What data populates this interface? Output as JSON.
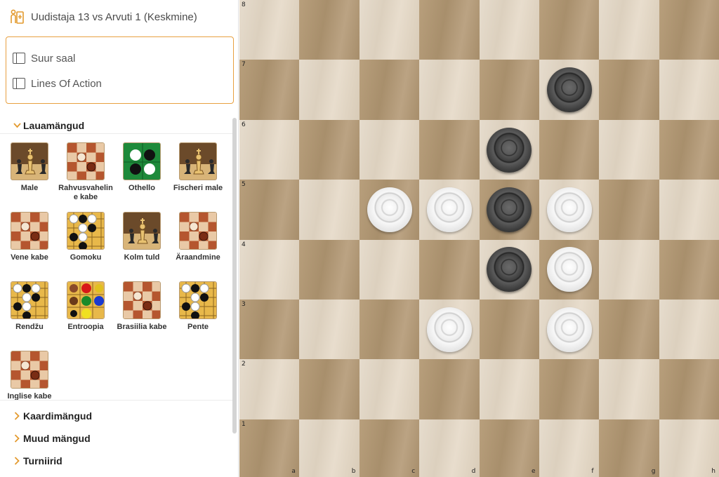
{
  "header": {
    "title": "Uudistaja 13 vs Arvuti 1 (Keskmine)"
  },
  "rooms": [
    {
      "label": "Suur saal"
    },
    {
      "label": "Lines Of Action"
    }
  ],
  "sections": {
    "board_games": "Lauamängud",
    "card_games": "Kaardimängud",
    "other_games": "Muud mängud",
    "tournaments": "Turniirid"
  },
  "games": [
    {
      "label": "Male",
      "icon": "chess-icon"
    },
    {
      "label": "Rahvusvaheline kabe",
      "icon": "checkers-icon"
    },
    {
      "label": "Othello",
      "icon": "othello-icon"
    },
    {
      "label": "Fischeri male",
      "icon": "chess-icon"
    },
    {
      "label": "Vene kabe",
      "icon": "checkers-icon"
    },
    {
      "label": "Gomoku",
      "icon": "gomoku-icon"
    },
    {
      "label": "Kolm tuld",
      "icon": "chess-icon"
    },
    {
      "label": "Äraandmine",
      "icon": "checkers-icon"
    },
    {
      "label": "Rendžu",
      "icon": "gomoku-icon"
    },
    {
      "label": "Entroopia",
      "icon": "entropy-icon"
    },
    {
      "label": "Brasiilia kabe",
      "icon": "checkers-icon"
    },
    {
      "label": "Pente",
      "icon": "gomoku-icon"
    },
    {
      "label": "Inglise kabe",
      "icon": "checkers-icon"
    }
  ],
  "board": {
    "files": [
      "a",
      "b",
      "c",
      "d",
      "e",
      "f",
      "g",
      "h"
    ],
    "ranks": [
      "8",
      "7",
      "6",
      "5",
      "4",
      "3",
      "2",
      "1"
    ],
    "pieces": [
      {
        "square": "f7",
        "color": "black"
      },
      {
        "square": "e6",
        "color": "black"
      },
      {
        "square": "c5",
        "color": "white"
      },
      {
        "square": "d5",
        "color": "white"
      },
      {
        "square": "e5",
        "color": "black"
      },
      {
        "square": "f5",
        "color": "white"
      },
      {
        "square": "e4",
        "color": "black"
      },
      {
        "square": "f4",
        "color": "white"
      },
      {
        "square": "d3",
        "color": "white"
      },
      {
        "square": "f3",
        "color": "white"
      }
    ]
  },
  "colors": {
    "accent": "#e8a040",
    "light_square": "#e2d7c6",
    "dark_square": "#b09876"
  }
}
